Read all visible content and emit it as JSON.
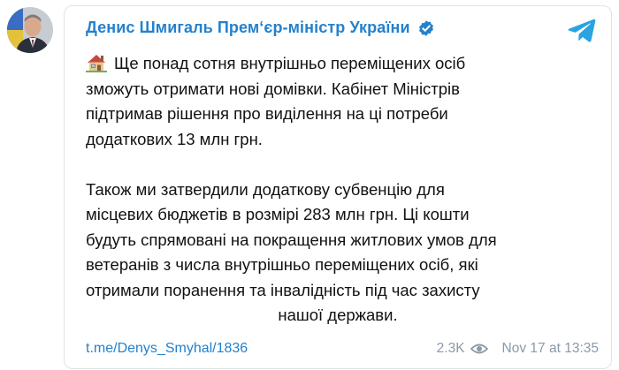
{
  "channel": {
    "name": "Денис Шмигаль Прем‘єр-міністр України",
    "verified": true
  },
  "post": {
    "paragraph1_lines": [
      "Ще понад сотня внутрішньо переміщених осіб",
      "зможуть отримати нові домівки. Кабінет Міністрів",
      "підтримав рішення про виділення на ці потреби",
      "додаткових 13 млн грн."
    ],
    "paragraph2_lines": [
      "Також ми затвердили додаткову субвенцію для",
      "місцевих бюджетів в розмірі 283 млн грн. Ці кошти",
      "будуть спрямовані на покращення житлових умов для",
      "ветеранів з числа внутрішньо переміщених осіб, які",
      "отримали поранення та інвалідність під час захисту",
      "нашої держави."
    ],
    "emoji": "house-icon",
    "link": "t.me/Denys_Smyhal/1836",
    "views": "2.3K",
    "timestamp": "Nov 17 at 13:35"
  },
  "icons": {
    "verified": "verified-badge-icon",
    "telegram": "telegram-logo-icon",
    "views": "eye-icon"
  },
  "colors": {
    "accent": "#2481cc",
    "text": "#111111",
    "muted": "#8a9aa9",
    "border": "#dfe3e7",
    "telegram": "#2aa3e0"
  }
}
